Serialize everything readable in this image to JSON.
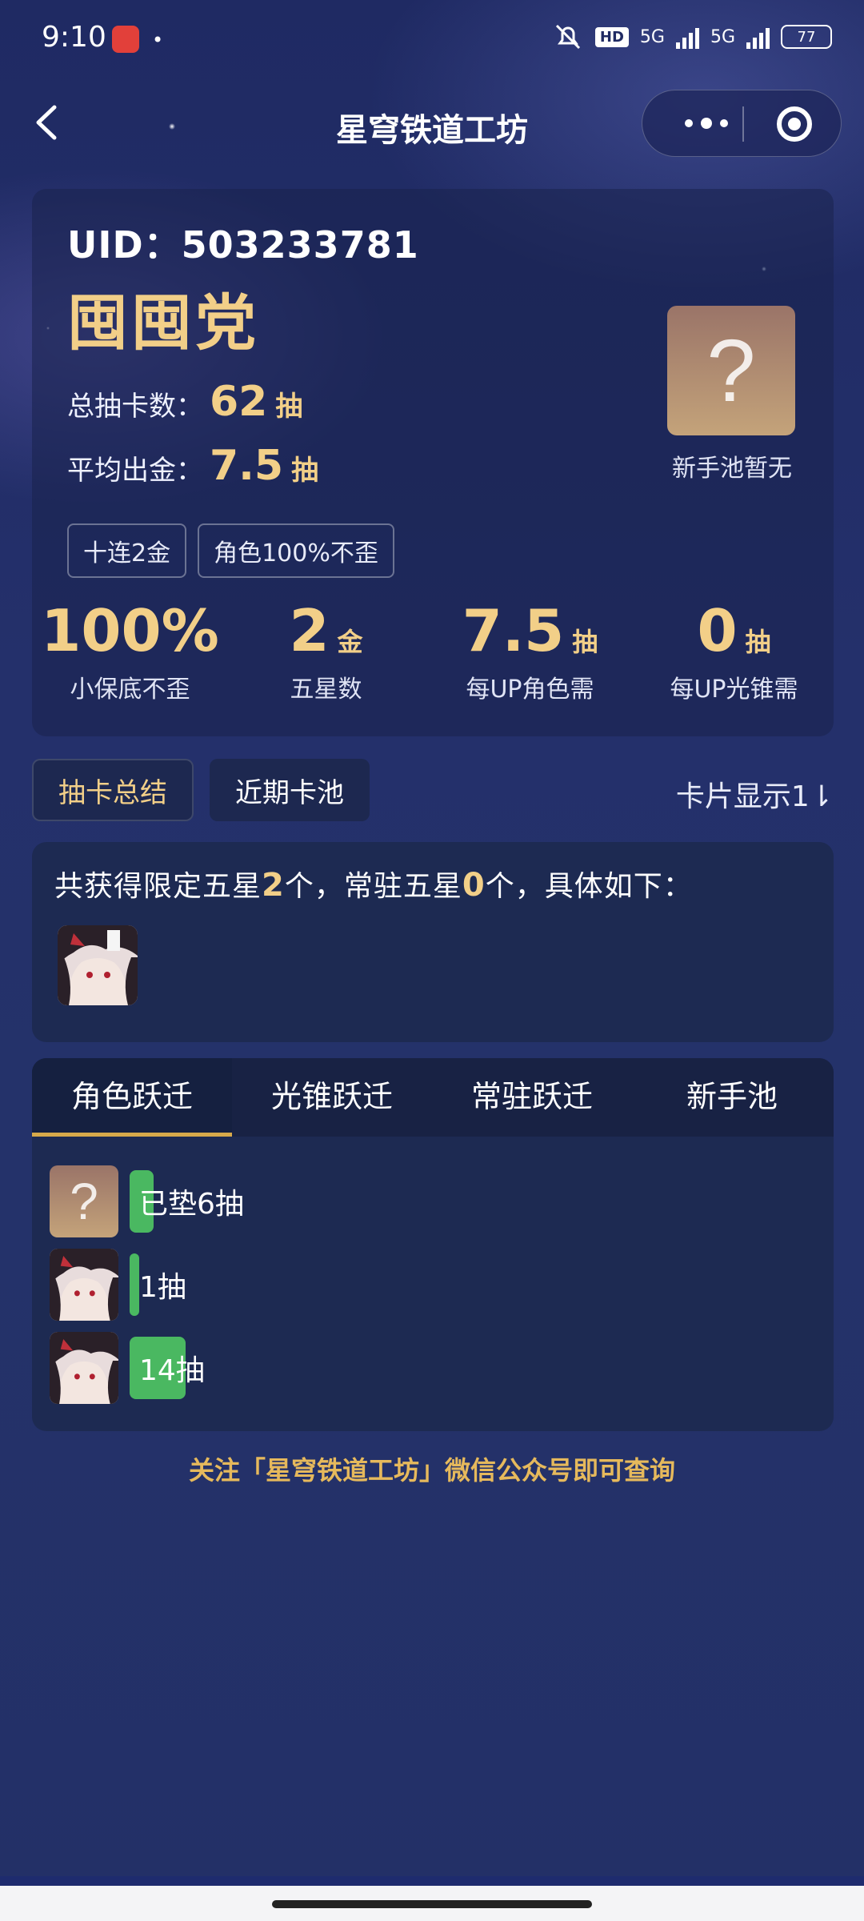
{
  "status_bar": {
    "time": "9:10",
    "network_1": "5G",
    "network_2": "5G",
    "hd": "HD",
    "battery": "77"
  },
  "nav": {
    "title": "星穹铁道工坊"
  },
  "profile": {
    "uid": "UID：503233781",
    "nickname": "囤囤党",
    "total_pulls_label": "总抽卡数：",
    "total_pulls_value": "62",
    "total_pulls_unit": "抽",
    "avg_gold_label": "平均出金：",
    "avg_gold_value": "7.5",
    "avg_gold_unit": "抽",
    "tags": [
      "十连2金",
      "角色100%不歪"
    ],
    "beginner_pool_symbol": "?",
    "beginner_pool_label": "新手池暂无"
  },
  "metrics": [
    {
      "value": "100%",
      "unit": "",
      "label": "小保底不歪"
    },
    {
      "value": "2",
      "unit": "金",
      "label": "五星数"
    },
    {
      "value": "7.5",
      "unit": "抽",
      "label": "每UP角色需"
    },
    {
      "value": "0",
      "unit": "抽",
      "label": "每UP光锥需"
    }
  ],
  "segments": {
    "active": "抽卡总结",
    "other": "近期卡池",
    "card_display": "卡片显示1⇂"
  },
  "summary": {
    "prefix": "共获得限定五星",
    "limited_count": "2",
    "middle": "个，常驻五星",
    "standard_count": "0",
    "suffix": "个，具体如下："
  },
  "warp_tabs": [
    "角色跃迁",
    "光锥跃迁",
    "常驻跃迁",
    "新手池"
  ],
  "warp_rows": [
    {
      "avatar": "mystery",
      "symbol": "?",
      "text": "已垫6抽",
      "pulls": 6
    },
    {
      "avatar": "character",
      "text": "1抽",
      "pulls": 1
    },
    {
      "avatar": "character",
      "text": "14抽",
      "pulls": 14
    }
  ],
  "footer": "关注「星穹铁道工坊」微信公众号即可查询",
  "colors": {
    "accent_gold": "#f2cf88",
    "bar_green": "#4ab861",
    "tab_underline": "#d7a94a"
  }
}
